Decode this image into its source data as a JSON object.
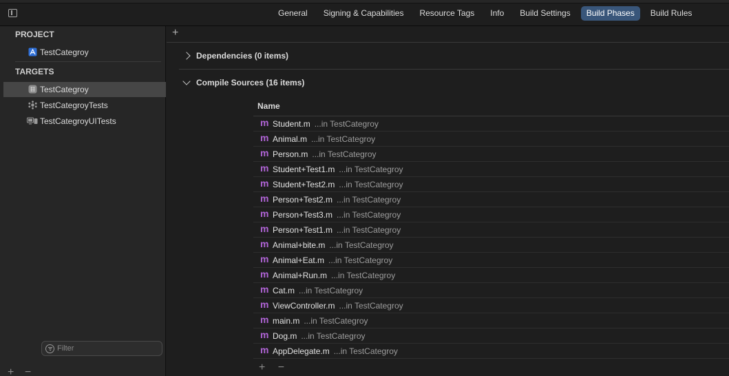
{
  "tabs": [
    "General",
    "Signing & Capabilities",
    "Resource Tags",
    "Info",
    "Build Settings",
    "Build Phases",
    "Build Rules"
  ],
  "active_tab": "Build Phases",
  "sidebar": {
    "project_header": "PROJECT",
    "project_item": "TestCategroy",
    "targets_header": "TARGETS",
    "targets": [
      "TestCategroy",
      "TestCategroyTests",
      "TestCategroyUITests"
    ],
    "filter_placeholder": "Filter"
  },
  "phases": {
    "dependencies": "Dependencies (0 items)",
    "compile_sources": "Compile Sources (16 items)"
  },
  "table": {
    "header": "Name",
    "rows": [
      {
        "name": "Student.m",
        "loc": "...in TestCategroy"
      },
      {
        "name": "Animal.m",
        "loc": "...in TestCategroy"
      },
      {
        "name": "Person.m",
        "loc": "...in TestCategroy"
      },
      {
        "name": "Student+Test1.m",
        "loc": "...in TestCategroy"
      },
      {
        "name": "Student+Test2.m",
        "loc": "...in TestCategroy"
      },
      {
        "name": "Person+Test2.m",
        "loc": "...in TestCategroy"
      },
      {
        "name": "Person+Test3.m",
        "loc": "...in TestCategroy"
      },
      {
        "name": "Person+Test1.m",
        "loc": "...in TestCategroy"
      },
      {
        "name": "Animal+bite.m",
        "loc": "...in TestCategroy"
      },
      {
        "name": "Animal+Eat.m",
        "loc": "...in TestCategroy"
      },
      {
        "name": "Animal+Run.m",
        "loc": "...in TestCategroy"
      },
      {
        "name": "Cat.m",
        "loc": "...in TestCategroy"
      },
      {
        "name": "ViewController.m",
        "loc": "...in TestCategroy"
      },
      {
        "name": "main.m",
        "loc": "...in TestCategroy"
      },
      {
        "name": "Dog.m",
        "loc": "...in TestCategroy"
      },
      {
        "name": "AppDelegate.m",
        "loc": "...in TestCategroy"
      }
    ]
  },
  "file_icon_glyph": "m",
  "plus_glyph": "+",
  "minus_glyph": "−",
  "colors": {
    "accent_tab": "#39567a",
    "file_icon": "#b064d6",
    "selection": "#464646"
  }
}
